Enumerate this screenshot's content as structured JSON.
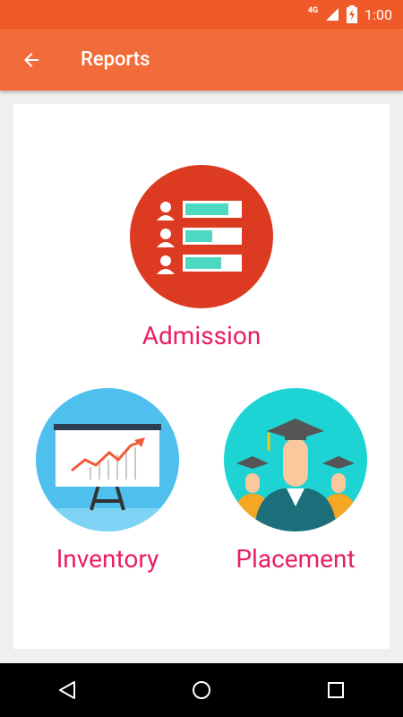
{
  "status_bar": {
    "network": "4G",
    "time": "1:00"
  },
  "toolbar": {
    "title": "Reports",
    "back_icon": "arrow-back-icon"
  },
  "reports": [
    {
      "label": "Admission",
      "icon": "admission-list-icon",
      "color": "#dc3b22"
    },
    {
      "label": "Inventory",
      "icon": "presentation-chart-icon",
      "color": "#4fc0ee"
    },
    {
      "label": "Placement",
      "icon": "graduates-icon",
      "color": "#1dd3d3"
    }
  ],
  "colors": {
    "status_bar": "#f05a28",
    "toolbar": "#f26b3a",
    "label": "#e91e63",
    "background": "#efefef"
  },
  "nav_bar": {
    "back": "nav-back-icon",
    "home": "nav-home-icon",
    "recents": "nav-recents-icon"
  }
}
